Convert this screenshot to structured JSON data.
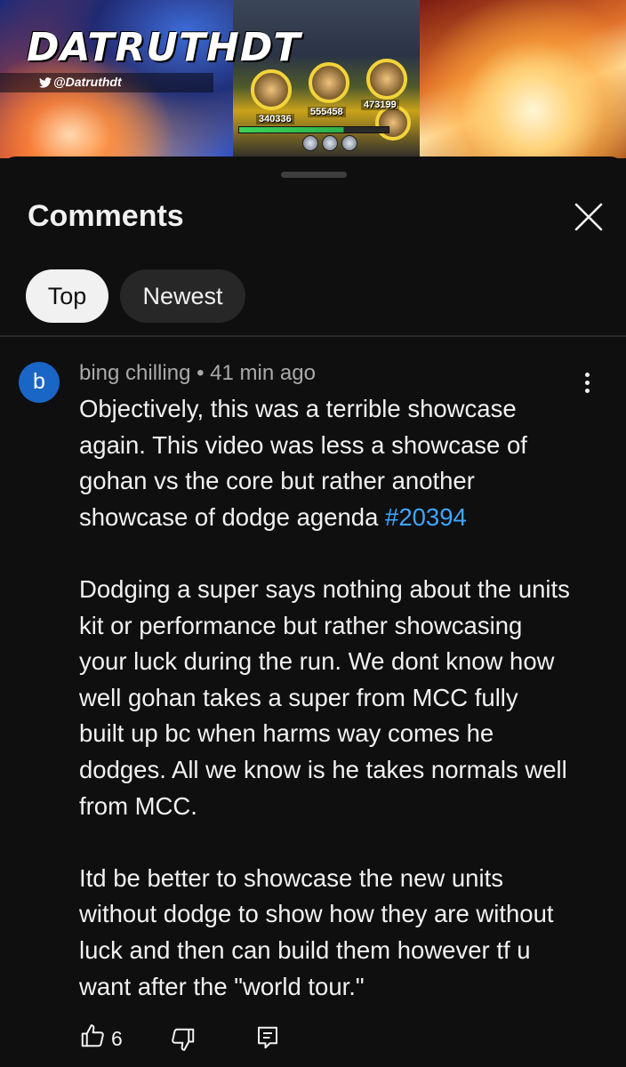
{
  "thumbnail": {
    "brand": "DATRUTHDT",
    "handle": "@Datruthdt",
    "game_numbers": [
      "340336",
      "555458",
      "473199"
    ]
  },
  "sheet": {
    "title": "Comments",
    "filters": {
      "top": "Top",
      "newest": "Newest",
      "selected": "Top"
    }
  },
  "comment": {
    "avatar_letter": "b",
    "author": "bing chilling",
    "separator": "•",
    "time": "41 min ago",
    "para1": {
      "line1": "Objectively, this was a terrible showcase",
      "line2": "again. This video was less a showcase of",
      "line3": "gohan vs the core but rather another",
      "line4": "showcase of dodge agenda",
      "hashtag": "#20394"
    },
    "para2": [
      "Dodging a super says nothing about the units",
      "kit or performance but rather showcasing",
      "your luck during the run. We dont know how",
      "well gohan takes a super from MCC fully",
      "built up bc when harms way comes he",
      "dodges. All we know is he takes normals well",
      "from MCC."
    ],
    "para3": [
      "Itd be better to showcase the new units",
      "without dodge to show how they are without",
      "luck and then can build them however tf u",
      "want after the \"world tour.\""
    ],
    "like_count": "6"
  },
  "icons": {
    "close": "close-icon",
    "more": "more-vert-icon",
    "like": "thumbs-up-icon",
    "dislike": "thumbs-down-icon",
    "reply": "reply-icon"
  },
  "colors": {
    "background": "#0f0f0f",
    "avatar": "#1966c7",
    "hashtag": "#3ea6ff",
    "chip_selected": "#f1f1f1",
    "chip_unselected": "#272727"
  }
}
